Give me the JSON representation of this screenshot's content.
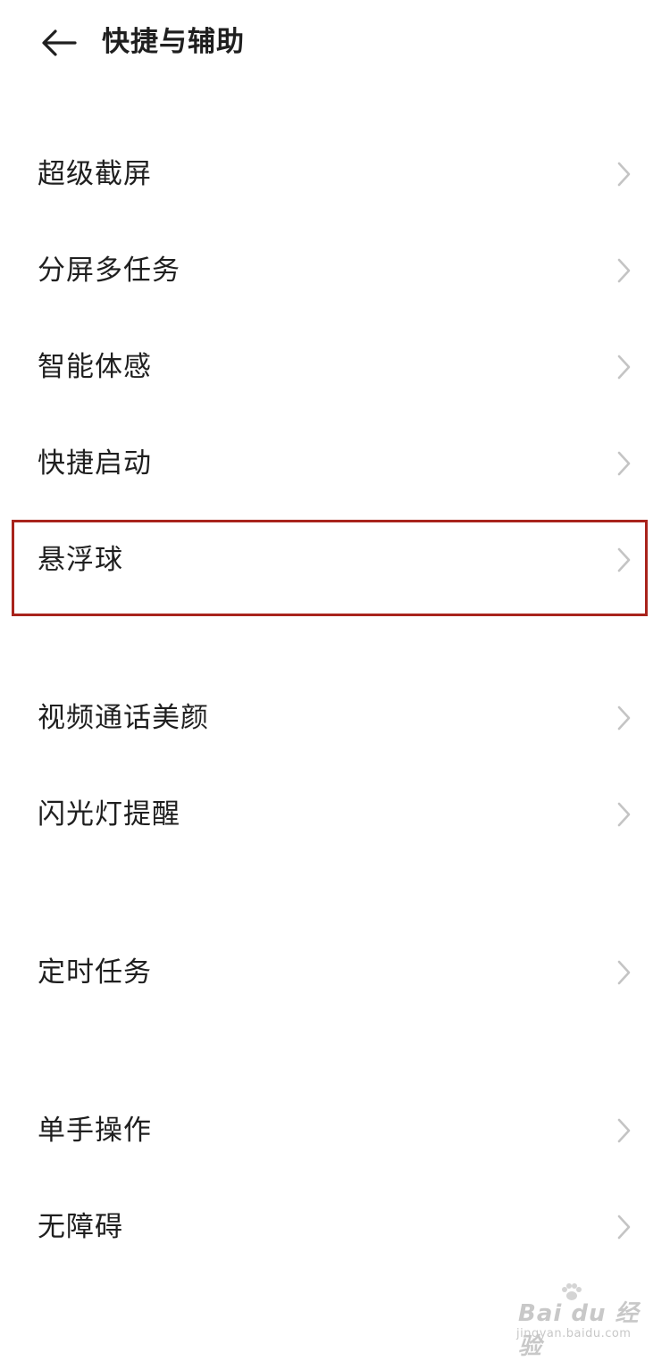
{
  "header": {
    "title": "快捷与辅助",
    "back_icon": "back-arrow-icon"
  },
  "items": [
    {
      "label": "超级截屏",
      "icon": "chevron-right-icon"
    },
    {
      "label": "分屏多任务",
      "icon": "chevron-right-icon"
    },
    {
      "label": "智能体感",
      "icon": "chevron-right-icon"
    },
    {
      "label": "快捷启动",
      "icon": "chevron-right-icon"
    },
    {
      "label": "悬浮球",
      "icon": "chevron-right-icon",
      "highlighted": true
    },
    {
      "label": "视频通话美颜",
      "icon": "chevron-right-icon"
    },
    {
      "label": "闪光灯提醒",
      "icon": "chevron-right-icon"
    },
    {
      "label": "定时任务",
      "icon": "chevron-right-icon"
    },
    {
      "label": "单手操作",
      "icon": "chevron-right-icon"
    },
    {
      "label": "无障碍",
      "icon": "chevron-right-icon"
    }
  ],
  "colors": {
    "highlight": "#a8231c",
    "chevron": "#c4c4c4",
    "text": "#1f1f1f"
  },
  "watermark": {
    "brand": "Bai du 经验",
    "url": "jingyan.baidu.com"
  }
}
